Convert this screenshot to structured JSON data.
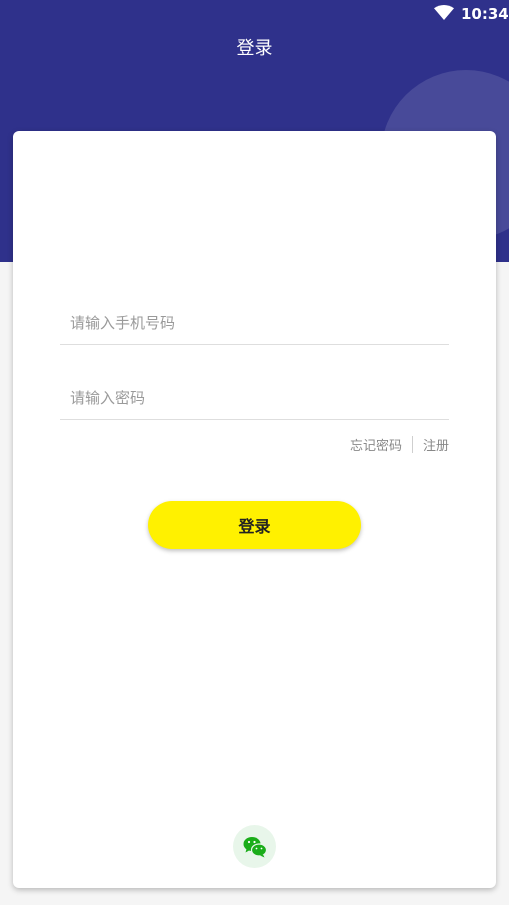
{
  "status_bar": {
    "time": "10:34",
    "wifi_icon": "wifi-icon"
  },
  "header": {
    "title": "登录"
  },
  "form": {
    "phone_placeholder": "请输入手机号码",
    "password_placeholder": "请输入密码",
    "forgot_password": "忘记密码",
    "register": "注册",
    "login_button": "登录"
  },
  "social": {
    "wechat_icon": "wechat-icon"
  },
  "colors": {
    "header_bg": "#2f318b",
    "button_bg": "#fff100",
    "wechat_green": "#1aad19"
  }
}
